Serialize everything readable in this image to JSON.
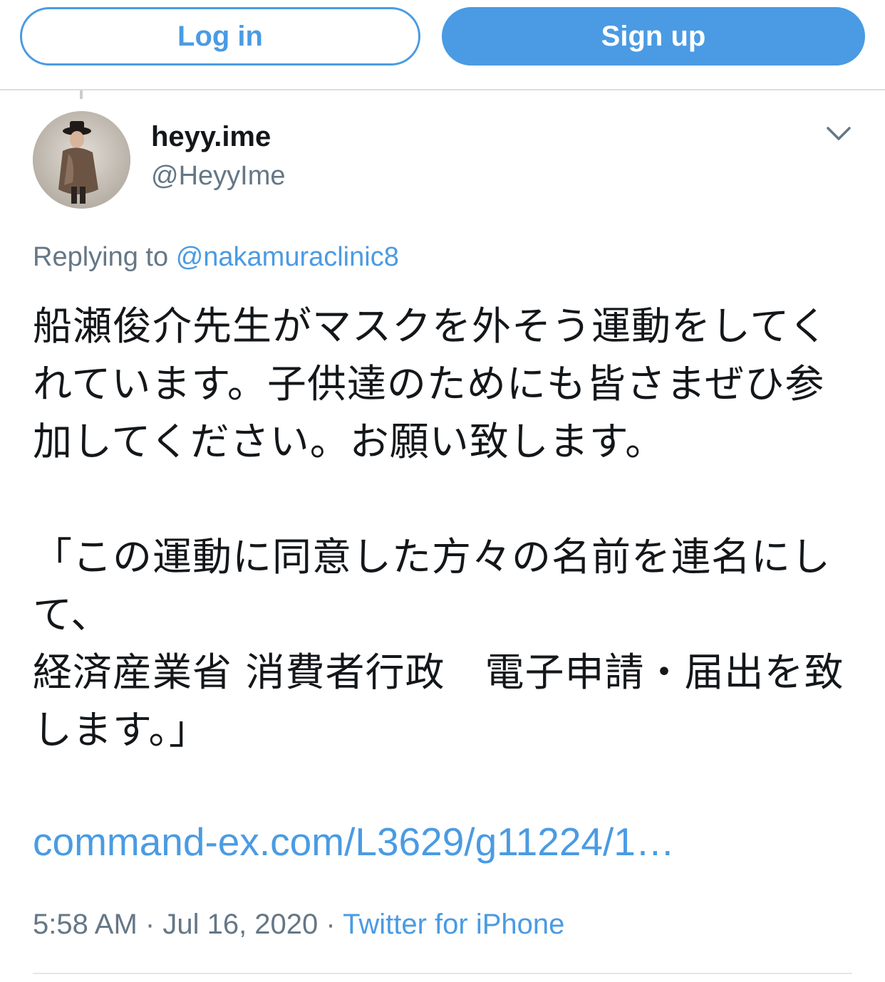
{
  "auth": {
    "login_label": "Log in",
    "signup_label": "Sign up"
  },
  "colors": {
    "accent": "#4a9be3",
    "secondary_text": "#657786",
    "primary_text": "#14171a"
  },
  "tweet": {
    "display_name": "heyy.ime",
    "handle": "@HeyyIme",
    "avatar_icon": "user-avatar",
    "menu_icon": "chevron-down-icon",
    "replying_prefix": "Replying to",
    "replying_to": "@nakamuraclinic8",
    "paragraphs": [
      "船瀬俊介先生がマスクを外そう運動をしてくれています。子供達のためにも皆さまぜひ参加してください。お願い致します。",
      "「この運動に同意した方々の名前を連名にして、\n経済産業省 消費者行政　電子申請・届出を致します。」"
    ],
    "link": "command-ex.com/L3629/g11224/1…",
    "time": "5:58 AM",
    "date": "Jul 16, 2020",
    "separator": "·",
    "source": "Twitter for iPhone"
  }
}
